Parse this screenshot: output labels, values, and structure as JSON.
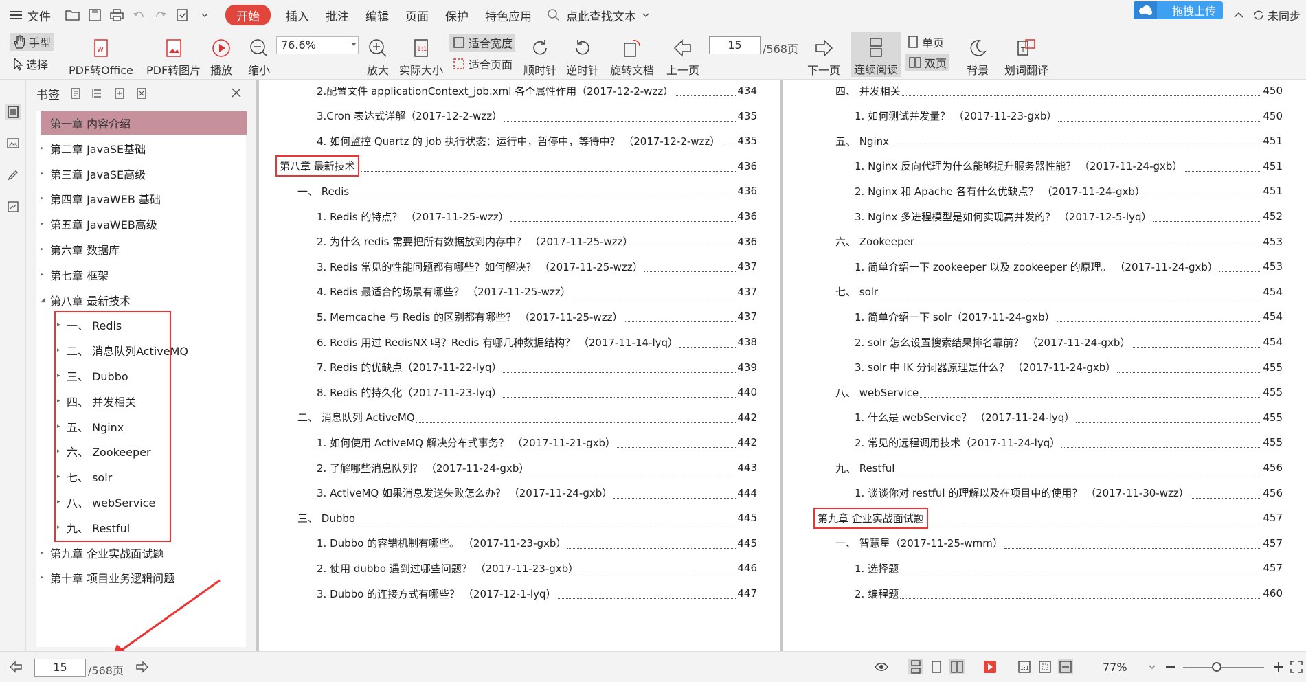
{
  "menu": {
    "file": "文件",
    "start": "开始",
    "tabs": [
      "插入",
      "批注",
      "编辑",
      "页面",
      "保护",
      "特色应用"
    ],
    "search_placeholder": "点此查找文本",
    "upload": "拖拽上传",
    "not_logged_in": "未同步"
  },
  "toolbar": {
    "hand": "手型",
    "select": "选择",
    "pdf_to_office": "PDF转Office",
    "pdf_to_image": "PDF转图片",
    "play": "播放",
    "zoom_out": "缩小",
    "zoom_value": "76.6%",
    "zoom_in": "放大",
    "actual_size": "实际大小",
    "fit_width": "适合宽度",
    "fit_page": "适合页面",
    "rotate_cw": "顺时针",
    "rotate_ccw": "逆时针",
    "rotate_doc": "旋转文档",
    "prev_page": "上一页",
    "current_page": "15",
    "total_pages": "/568页",
    "next_page": "下一页",
    "continuous": "连续阅读",
    "single": "单页",
    "double": "双页",
    "background": "背景",
    "translate": "划词翻译"
  },
  "sidebar": {
    "title": "书签",
    "items": [
      {
        "label": "第一章  内容介绍",
        "level": 0,
        "expandable": false,
        "selected": true
      },
      {
        "label": "第二章  JavaSE基础",
        "level": 0,
        "expandable": true
      },
      {
        "label": "第三章  JavaSE高级",
        "level": 0,
        "expandable": true
      },
      {
        "label": "第四章  JavaWEB 基础",
        "level": 0,
        "expandable": true
      },
      {
        "label": "第五章  JavaWEB高级",
        "level": 0,
        "expandable": true
      },
      {
        "label": "第六章  数据库",
        "level": 0,
        "expandable": true
      },
      {
        "label": "第七章  框架",
        "level": 0,
        "expandable": true
      },
      {
        "label": "第八章  最新技术",
        "level": 0,
        "expanded": true
      },
      {
        "label": "一、  Redis",
        "level": 1,
        "expandable": true
      },
      {
        "label": "二、  消息队列ActiveMQ",
        "level": 1,
        "expandable": true
      },
      {
        "label": "三、  Dubbo",
        "level": 1,
        "expandable": true
      },
      {
        "label": "四、  并发相关",
        "level": 1,
        "expandable": true
      },
      {
        "label": "五、  Nginx",
        "level": 1,
        "expandable": true
      },
      {
        "label": "六、  Zookeeper",
        "level": 1,
        "expandable": true
      },
      {
        "label": "七、  solr",
        "level": 1,
        "expandable": true
      },
      {
        "label": "八、  webService",
        "level": 1,
        "expandable": true
      },
      {
        "label": "九、  Restful",
        "level": 1,
        "expandable": true
      },
      {
        "label": "第九章  企业实战面试题",
        "level": 0,
        "expandable": true
      },
      {
        "label": "第十章  项目业务逻辑问题",
        "level": 0,
        "expandable": true
      }
    ]
  },
  "left_page": [
    {
      "text": "2.配置文件 applicationContext_job.xml 各个属性作用（2017-12-2-wzz）",
      "page": "434",
      "indent": 2
    },
    {
      "text": "3.Cron 表达式详解（2017-12-2-wzz）",
      "page": "435",
      "indent": 2
    },
    {
      "text": "4. 如何监控 Quartz 的 job 执行状态：运行中，暂停中，等待中？ （2017-12-2-wzz）",
      "page": "435",
      "indent": 2
    },
    {
      "text": "第八章  最新技术",
      "page": "436",
      "indent": 0,
      "boxed": true
    },
    {
      "text": "一、  Redis",
      "page": "436",
      "indent": 1
    },
    {
      "text": "1. Redis 的特点？ （2017-11-25-wzz）",
      "page": "436",
      "indent": 2
    },
    {
      "text": "2. 为什么 redis 需要把所有数据放到内存中？ （2017-11-25-wzz）",
      "page": "436",
      "indent": 2
    },
    {
      "text": "3. Redis 常见的性能问题都有哪些？如何解决？ （2017-11-25-wzz）",
      "page": "437",
      "indent": 2
    },
    {
      "text": "4. Redis 最适合的场景有哪些？ （2017-11-25-wzz）",
      "page": "437",
      "indent": 2
    },
    {
      "text": "5. Memcache 与 Redis 的区别都有哪些？ （2017-11-25-wzz）",
      "page": "437",
      "indent": 2
    },
    {
      "text": "6. Redis 用过 RedisNX 吗？Redis 有哪几种数据结构？ （2017-11-14-lyq）",
      "page": "438",
      "indent": 2
    },
    {
      "text": "7. Redis 的优缺点（2017-11-22-lyq）",
      "page": "439",
      "indent": 2
    },
    {
      "text": "8. Redis 的持久化（2017-11-23-lyq）",
      "page": "440",
      "indent": 2
    },
    {
      "text": "二、  消息队列 ActiveMQ",
      "page": "442",
      "indent": 1
    },
    {
      "text": "1. 如何使用 ActiveMQ 解决分布式事务？ （2017-11-21-gxb）",
      "page": "442",
      "indent": 2
    },
    {
      "text": "2. 了解哪些消息队列？ （2017-11-24-gxb）",
      "page": "443",
      "indent": 2
    },
    {
      "text": "3. ActiveMQ 如果消息发送失败怎么办？ （2017-11-24-gxb）",
      "page": "444",
      "indent": 2
    },
    {
      "text": "三、  Dubbo",
      "page": "445",
      "indent": 1
    },
    {
      "text": "1. Dubbo 的容错机制有哪些。 （2017-11-23-gxb）",
      "page": "445",
      "indent": 2
    },
    {
      "text": "2. 使用 dubbo 遇到过哪些问题？ （2017-11-23-gxb）",
      "page": "446",
      "indent": 2
    },
    {
      "text": "3. Dubbo 的连接方式有哪些？ （2017-12-1-lyq）",
      "page": "447",
      "indent": 2
    }
  ],
  "right_page": [
    {
      "text": "四、  并发相关",
      "page": "450",
      "indent": 1
    },
    {
      "text": "1. 如何测试并发量？ （2017-11-23-gxb）",
      "page": "450",
      "indent": 2
    },
    {
      "text": "五、  Nginx",
      "page": "451",
      "indent": 1
    },
    {
      "text": "1. Nginx 反向代理为什么能够提升服务器性能？ （2017-11-24-gxb）",
      "page": "451",
      "indent": 2
    },
    {
      "text": "2. Nginx 和 Apache 各有什么优缺点？ （2017-11-24-gxb）",
      "page": "451",
      "indent": 2
    },
    {
      "text": "3. Nginx 多进程模型是如何实现高并发的？ （2017-12-5-lyq）",
      "page": "452",
      "indent": 2
    },
    {
      "text": "六、  Zookeeper",
      "page": "453",
      "indent": 1
    },
    {
      "text": "1. 简单介绍一下 zookeeper 以及 zookeeper 的原理。 （2017-11-24-gxb）",
      "page": "453",
      "indent": 2
    },
    {
      "text": "七、  solr",
      "page": "454",
      "indent": 1
    },
    {
      "text": "1. 简单介绍一下 solr（2017-11-24-gxb）",
      "page": "454",
      "indent": 2
    },
    {
      "text": "2. solr 怎么设置搜索结果排名靠前？ （2017-11-24-gxb）",
      "page": "454",
      "indent": 2
    },
    {
      "text": "3. solr 中 IK 分词器原理是什么？ （2017-11-24-gxb）",
      "page": "455",
      "indent": 2
    },
    {
      "text": "八、  webService",
      "page": "455",
      "indent": 1
    },
    {
      "text": "1. 什么是 webService？ （2017-11-24-lyq）",
      "page": "455",
      "indent": 2
    },
    {
      "text": "2. 常见的远程调用技术（2017-11-24-lyq）",
      "page": "455",
      "indent": 2
    },
    {
      "text": "九、  Restful",
      "page": "456",
      "indent": 1
    },
    {
      "text": "1. 谈谈你对 restful 的理解以及在项目中的使用？ （2017-11-30-wzz）",
      "page": "456",
      "indent": 2
    },
    {
      "text": "第九章  企业实战面试题",
      "page": "457",
      "indent": 0,
      "boxed": true
    },
    {
      "text": "一、  智慧星（2017-11-25-wmm）",
      "page": "457",
      "indent": 1
    },
    {
      "text": "1. 选择题",
      "page": "457",
      "indent": 2
    },
    {
      "text": "2. 编程题",
      "page": "460",
      "indent": 2
    }
  ],
  "bottom": {
    "current_page": "15",
    "total_pages": "/568页",
    "zoom": "77%"
  },
  "colors": {
    "accent": "#e2453c",
    "selected_bookmark": "#c6919b",
    "annotation_red": "#e33333",
    "upload_blue": "#3ea0f0"
  }
}
